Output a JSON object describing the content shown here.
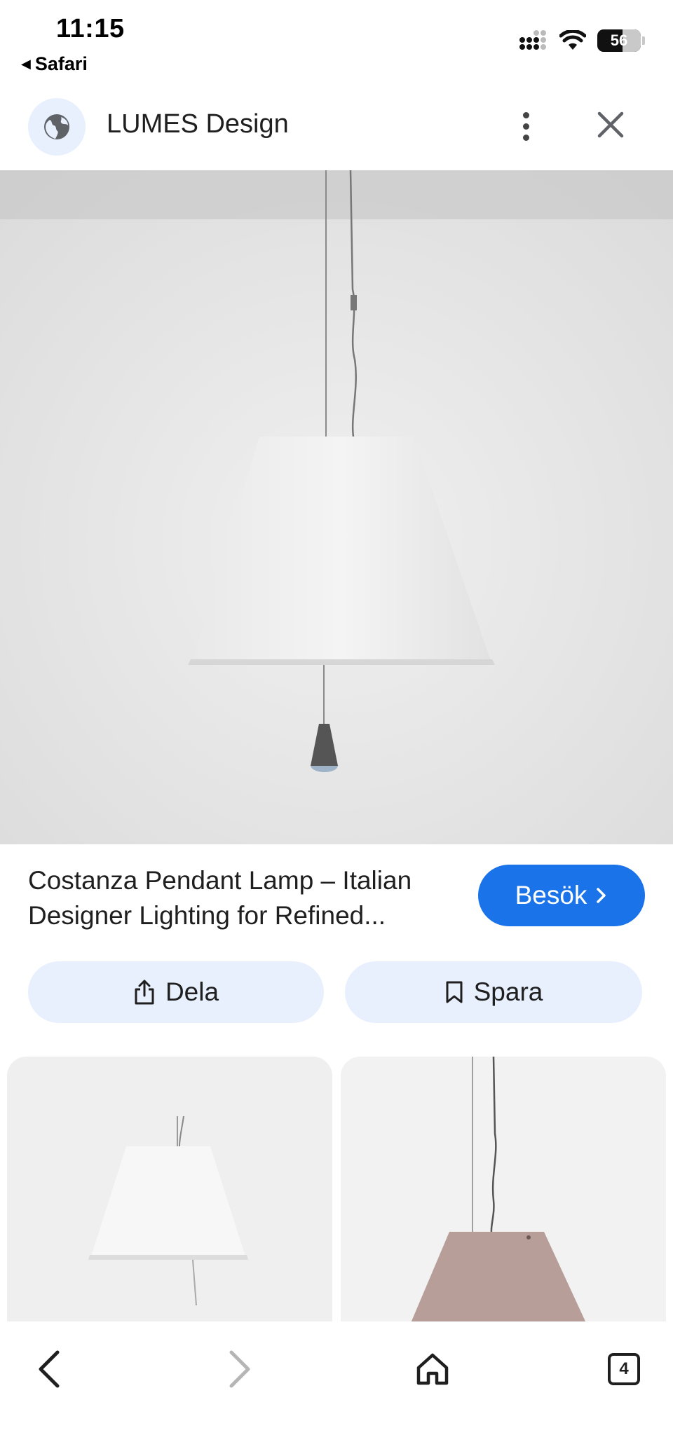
{
  "status_bar": {
    "time": "11:15",
    "back_app": "Safari",
    "battery": "56"
  },
  "header": {
    "site_title": "LUMES Design"
  },
  "result": {
    "title": "Costanza Pendant Lamp – Italian Designer Lighting for Refined...",
    "visit_label": "Besök",
    "share_label": "Dela",
    "save_label": "Spara"
  },
  "toolbar": {
    "tabs_count": "4"
  },
  "colors": {
    "accent": "#1a73e8",
    "chip_background": "#e8f0fe"
  }
}
